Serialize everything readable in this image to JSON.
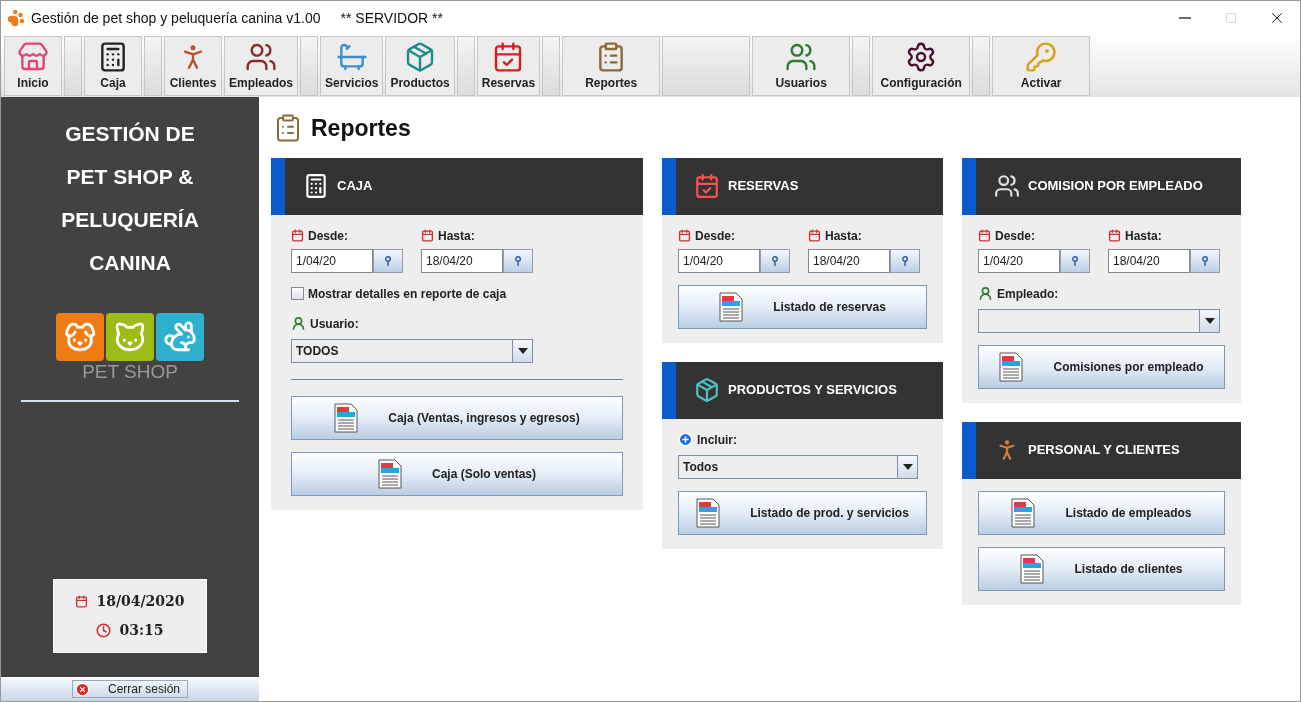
{
  "window": {
    "title": "Gestión de pet shop y peluquería canina v1.00",
    "subtitle": "** SERVIDOR **"
  },
  "toolbar": [
    {
      "kind": "button",
      "label": "Inicio"
    },
    {
      "kind": "spacer"
    },
    {
      "kind": "button",
      "label": "Caja"
    },
    {
      "kind": "spacer"
    },
    {
      "kind": "button",
      "label": "Clientes"
    },
    {
      "kind": "button",
      "label": "Empleados"
    },
    {
      "kind": "spacer"
    },
    {
      "kind": "button",
      "label": "Servicios"
    },
    {
      "kind": "button",
      "label": "Productos"
    },
    {
      "kind": "spacer"
    },
    {
      "kind": "button",
      "label": "Reservas"
    },
    {
      "kind": "spacer"
    },
    {
      "kind": "large",
      "label": "Reportes"
    },
    {
      "kind": "blank"
    },
    {
      "kind": "large",
      "label": "Usuarios"
    },
    {
      "kind": "spacer"
    },
    {
      "kind": "large",
      "label": "Configuración"
    },
    {
      "kind": "spacer"
    },
    {
      "kind": "large",
      "label": "Activar"
    }
  ],
  "sidebar": {
    "title_lines": [
      "GESTIÓN DE",
      "PET SHOP &",
      "PELUQUERÍA",
      "CANINA"
    ],
    "logo_text": "PET SHOP",
    "date": "18/04/2020",
    "time": "03:15",
    "logout": "Cerrar sesión"
  },
  "page": {
    "title": "Reportes"
  },
  "columns": [
    [
      {
        "title": "CAJA",
        "items": [
          {
            "kind": "dates",
            "from_label": "Desde:",
            "from": "1/04/20",
            "to_label": "Hasta:",
            "to": "18/04/20"
          },
          {
            "kind": "checkbox",
            "label": "Mostrar detalles en reporte de caja",
            "checked": false
          },
          {
            "kind": "select",
            "label": "Usuario:",
            "value": "TODOS"
          },
          {
            "kind": "separator"
          },
          {
            "kind": "button",
            "label": "Caja (Ventas, ingresos y egresos)"
          },
          {
            "kind": "button",
            "label": "Caja (Solo ventas)"
          }
        ]
      }
    ],
    [
      {
        "title": "RESERVAS",
        "items": [
          {
            "kind": "dates",
            "from_label": "Desde:",
            "from": "1/04/20",
            "to_label": "Hasta:",
            "to": "18/04/20"
          },
          {
            "kind": "button",
            "label": "Listado de reservas"
          }
        ]
      },
      {
        "title": "PRODUCTOS Y SERVICIOS",
        "items": [
          {
            "kind": "include",
            "label": "Incluir:",
            "value": "Todos"
          },
          {
            "kind": "button",
            "label": "Listado de prod. y servicios"
          }
        ]
      }
    ],
    [
      {
        "title": "COMISION POR EMPLEADO",
        "items": [
          {
            "kind": "dates",
            "from_label": "Desde:",
            "from": "1/04/20",
            "to_label": "Hasta:",
            "to": "18/04/20"
          },
          {
            "kind": "select",
            "label": "Empleado:"
          },
          {
            "kind": "button",
            "label": "Comisiones por empleado"
          }
        ]
      },
      {
        "title": "PERSONAL Y CLIENTES",
        "items": [
          {
            "kind": "button",
            "label": "Listado de empleados"
          },
          {
            "kind": "button",
            "label": "Listado de clientes"
          }
        ]
      }
    ]
  ]
}
